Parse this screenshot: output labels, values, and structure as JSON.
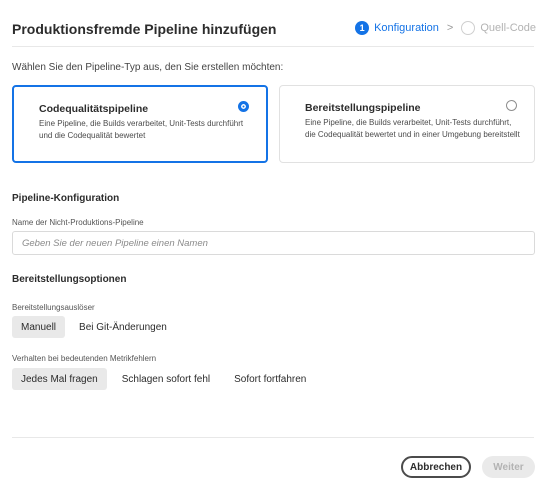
{
  "dialog": {
    "title": "Produktionsfremde Pipeline hinzufügen",
    "steps": [
      {
        "number": "1",
        "label": "Konfiguration",
        "state": "active"
      },
      {
        "label": "Quell-Code",
        "state": "inactive"
      }
    ],
    "step_separator": ">"
  },
  "pipeline_type": {
    "prompt": "Wählen Sie den Pipeline-Typ aus, den Sie erstellen möchten:",
    "options": [
      {
        "title": "Codequalitätspipeline",
        "description": "Eine Pipeline, die Builds verarbeitet, Unit-Tests durchführt und die Codequalität bewertet",
        "selected": true
      },
      {
        "title": "Bereitstellungspipeline",
        "description": "Eine Pipeline, die Builds verarbeitet, Unit-Tests durchführt, die Codequalität bewertet und in einer Umgebung bereitstellt",
        "selected": false
      }
    ]
  },
  "pipeline_config": {
    "section_title": "Pipeline-Konfiguration",
    "name_label": "Name der Nicht-Produktions-Pipeline",
    "name_value": "",
    "name_placeholder": "Geben Sie der neuen Pipeline einen Namen"
  },
  "deploy_options": {
    "section_title": "Bereitstellungsoptionen",
    "trigger_label": "Bereitstellungsauslöser",
    "trigger_options": [
      {
        "label": "Manuell",
        "selected": true
      },
      {
        "label": "Bei Git-Änderungen",
        "selected": false
      }
    ],
    "metric_label": "Verhalten bei bedeutenden Metrikfehlern",
    "metric_options": [
      {
        "label": "Jedes Mal fragen",
        "selected": true
      },
      {
        "label": "Schlagen sofort fehl",
        "selected": false
      },
      {
        "label": "Sofort fortfahren",
        "selected": false
      }
    ]
  },
  "footer": {
    "cancel_label": "Abbrechen",
    "next_label": "Weiter",
    "next_enabled": false
  },
  "colors": {
    "accent": "#1473e6",
    "selected_segment_bg": "#e9e9e9",
    "disabled_button_bg": "#eaeaea"
  }
}
